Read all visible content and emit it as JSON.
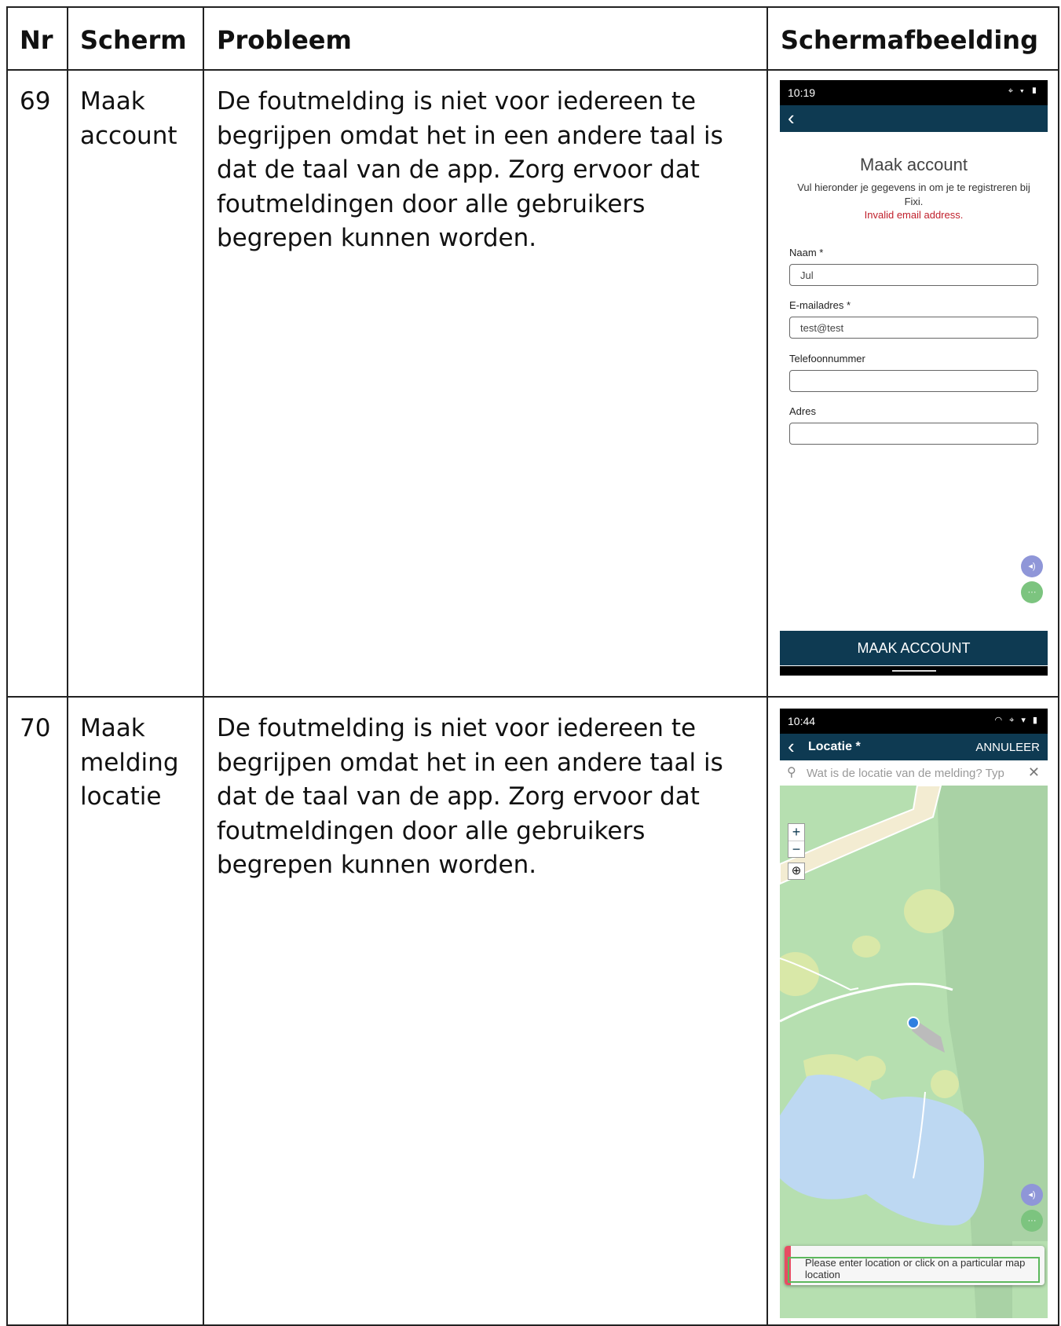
{
  "table": {
    "headers": {
      "nr": "Nr",
      "scherm": "Scherm",
      "probleem": "Probleem",
      "schermafbeelding": "Schermafbeelding"
    },
    "rows": [
      {
        "nr": "69",
        "scherm": "Maak account",
        "probleem": "De foutmelding is niet voor iedereen te begrijpen omdat het in een andere taal is dat de taal van de app. Zorg ervoor dat foutmeldingen door alle gebruikers begrepen kunnen worden."
      },
      {
        "nr": "70",
        "scherm": "Maak melding locatie",
        "probleem": "De foutmelding is niet voor iedereen te begrijpen omdat het in een andere taal is dat de taal van de app. Zorg ervoor dat foutmeldingen door alle gebruikers begrepen kunnen worden."
      }
    ]
  },
  "screen1": {
    "time": "10:19",
    "title": "Maak account",
    "subtitle": "Vul hieronder je gegevens in om je te registreren bij Fixi.",
    "error": "Invalid email address.",
    "fields": [
      {
        "label": "Naam *",
        "value": "Jul"
      },
      {
        "label": "E-mailadres *",
        "value": "test@test"
      },
      {
        "label": "Telefoonnummer",
        "value": ""
      },
      {
        "label": "Adres",
        "value": ""
      }
    ],
    "submit": "MAAK ACCOUNT"
  },
  "screen2": {
    "time": "10:44",
    "title": "Locatie *",
    "cancel": "ANNULEER",
    "search_placeholder": "Wat is de locatie van de melding? Typ",
    "zoom_in": "+",
    "zoom_out": "−",
    "toast": "Please enter location or click on a particular map location"
  },
  "colors": {
    "navy": "#0e3a52",
    "error": "#c0202c",
    "map_green": "#b6dfb0",
    "water": "#bdd8f2"
  }
}
